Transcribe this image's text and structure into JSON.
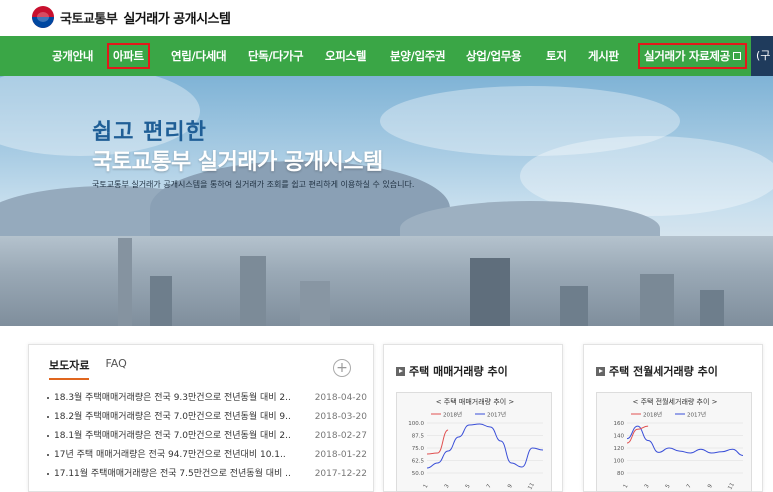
{
  "header": {
    "ministry": "국토교통부",
    "system": "실거래가 공개시스템"
  },
  "nav": {
    "items": [
      {
        "label": "공개안내",
        "boxed": false
      },
      {
        "label": "아파트",
        "boxed": true
      },
      {
        "label": "연립/다세대",
        "boxed": false
      },
      {
        "label": "단독/다가구",
        "boxed": false
      },
      {
        "label": "오피스텔",
        "boxed": false
      },
      {
        "label": "분양/입주권",
        "boxed": false
      },
      {
        "label": "상업/업무용",
        "boxed": false
      },
      {
        "label": "토지",
        "boxed": false
      },
      {
        "label": "게시판",
        "boxed": false
      },
      {
        "label": "실거래가 자료제공",
        "boxed": true
      }
    ],
    "extra": "(구"
  },
  "hero": {
    "subtitle": "쉽고 편리한",
    "title": "국토교통부 실거래가 공개시스템",
    "description": "국토교통부 실거래가 공개시스템을 통하여 실거래가 조회를 쉽고 편리하게 이용하실 수 있습니다."
  },
  "news": {
    "tabs": [
      "보도자료",
      "FAQ"
    ],
    "more": "+",
    "items": [
      {
        "title": "18.3월 주택매매거래량은 전국 9.3만건으로 전년동월 대비 2..",
        "date": "2018-04-20"
      },
      {
        "title": "18.2월 주택매매거래량은 전국 7.0만건으로 전년동월 대비 9..",
        "date": "2018-03-20"
      },
      {
        "title": "18.1월 주택매매거래량은 전국 7.0만건으로 전년동월 대비 2..",
        "date": "2018-02-27"
      },
      {
        "title": "17년 주택 매매거래량은 전국 94.7만건으로 전년대비 10.1..",
        "date": "2018-01-22"
      },
      {
        "title": "17.11월 주택매매거래량은 전국 7.5만건으로 전년동월 대비 ..",
        "date": "2017-12-22"
      }
    ]
  },
  "charts": {
    "sale": {
      "panel_title": "주택 매매거래량 추이",
      "inner_title": "< 주택 매매거래량 추이 >"
    },
    "rent": {
      "panel_title": "주택 전월세거래량 추이",
      "inner_title": "< 주택 전월세거래량 추이 >"
    }
  },
  "colors": {
    "nav_green": "#3aa646",
    "highlight_red": "#e3191b",
    "series_2018": "#e05050",
    "series_2017": "#3a4fd8"
  },
  "chart_data": [
    {
      "type": "line",
      "title": "< 주택 매매거래량 추이 >",
      "categories": [
        "1",
        "3",
        "5",
        "7",
        "9",
        "11"
      ],
      "x": [
        1,
        2,
        3,
        4,
        5,
        6,
        7,
        8,
        9,
        10,
        11,
        12
      ],
      "series": [
        {
          "name": "2018년",
          "color": "#e05050",
          "values": [
            69,
            70,
            93
          ]
        },
        {
          "name": "2017년",
          "color": "#3a4fd8",
          "values": [
            55,
            60,
            72,
            86,
            98,
            99,
            96,
            82,
            60,
            56,
            75,
            73
          ]
        }
      ],
      "yticks": [
        "100.0",
        "87.5",
        "75.0",
        "62.5",
        "50.0"
      ],
      "ylim": [
        50,
        100
      ],
      "legend": "top"
    },
    {
      "type": "line",
      "title": "< 주택 전월세거래량 추이 >",
      "categories": [
        "1",
        "3",
        "5",
        "7",
        "9",
        "11"
      ],
      "x": [
        1,
        2,
        3,
        4,
        5,
        6,
        7,
        8,
        9,
        10,
        11,
        12
      ],
      "series": [
        {
          "name": "2018년",
          "color": "#e05050",
          "values": [
            128,
            150,
            155
          ]
        },
        {
          "name": "2017년",
          "color": "#3a4fd8",
          "values": [
            135,
            155,
            132,
            113,
            120,
            115,
            112,
            118,
            112,
            114,
            118,
            108
          ]
        }
      ],
      "yticks": [
        "160",
        "140",
        "120",
        "100",
        "80"
      ],
      "ylim": [
        80,
        160
      ],
      "legend": "top"
    }
  ]
}
